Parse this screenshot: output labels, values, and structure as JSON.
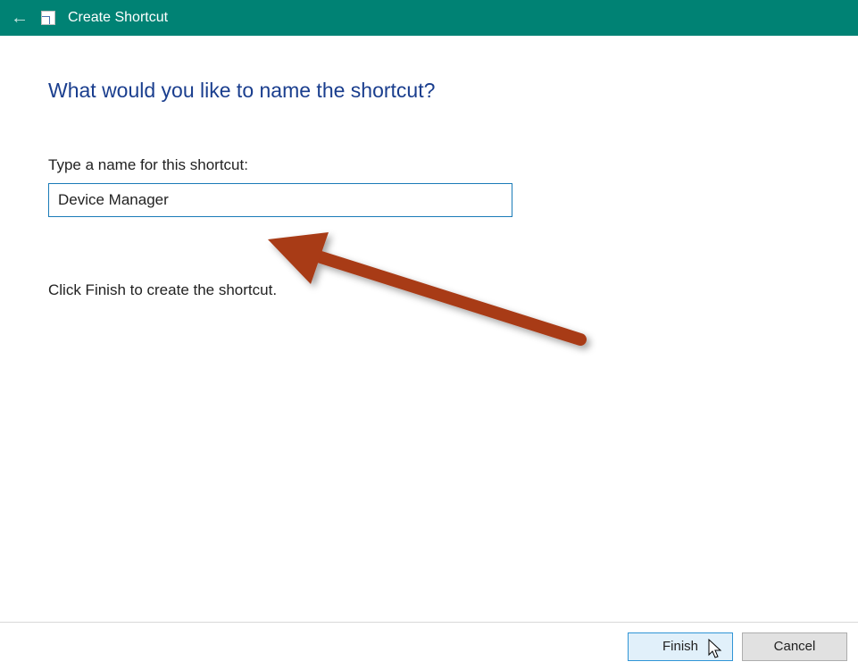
{
  "titlebar": {
    "title": "Create Shortcut"
  },
  "main": {
    "heading": "What would you like to name the shortcut?",
    "field_label": "Type a name for this shortcut:",
    "shortcut_name_value": "Device Manager",
    "instruction": "Click Finish to create the shortcut."
  },
  "footer": {
    "finish_label": "Finish",
    "cancel_label": "Cancel"
  },
  "colors": {
    "titlebar_bg": "#008274",
    "heading_color": "#1a3e8e",
    "input_border": "#1a7bb8",
    "finish_bg": "#e1f0fa",
    "finish_border": "#3095d6",
    "cancel_bg": "#e1e1e1",
    "annotation_arrow": "#a83a18"
  }
}
